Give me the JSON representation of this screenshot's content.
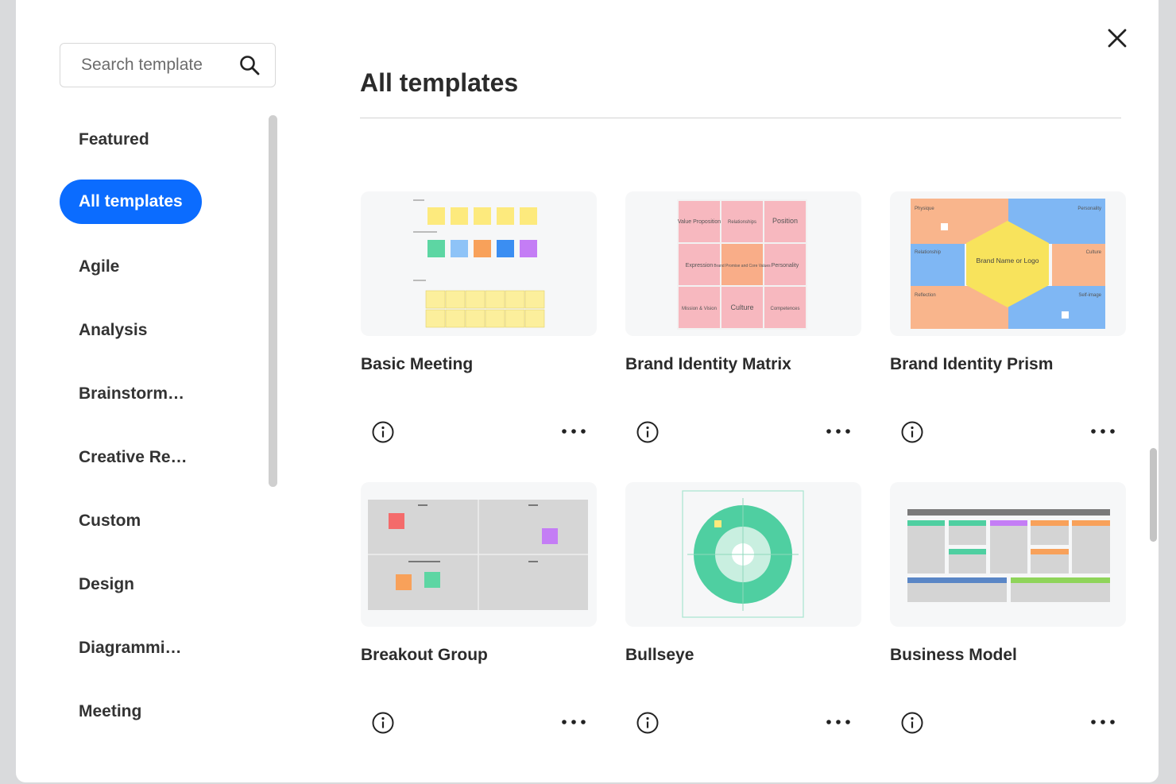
{
  "search": {
    "placeholder": "Search template"
  },
  "sidebar": {
    "items": [
      {
        "label": "Featured"
      },
      {
        "label": "All templates",
        "active": true
      },
      {
        "label": "Agile"
      },
      {
        "label": "Analysis"
      },
      {
        "label": "Brainstorm…"
      },
      {
        "label": "Creative Re…"
      },
      {
        "label": "Custom"
      },
      {
        "label": "Design"
      },
      {
        "label": "Diagrammi…"
      },
      {
        "label": "Meeting"
      }
    ]
  },
  "main": {
    "title": "All templates",
    "cards": [
      {
        "name": "Basic Meeting"
      },
      {
        "name": "Brand Identity Matrix",
        "cells": [
          "Value Proposition",
          "Relationships",
          "Position",
          "Expression",
          "Brand Promise and Core Values",
          "Personality",
          "Mission & Vision",
          "Culture",
          "Competences"
        ]
      },
      {
        "name": "Brand Identity Prism",
        "center": "Brand Name or Logo",
        "labels": [
          "Physique",
          "Personality",
          "Relationship",
          "Culture",
          "Reflection",
          "Self-image"
        ]
      },
      {
        "name": "Breakout Group"
      },
      {
        "name": "Bullseye"
      },
      {
        "name": "Business Model"
      }
    ]
  },
  "colors": {
    "accent": "#0b6cff",
    "sticky_yellow": "#fdea7d",
    "sticky_green": "#5dd6a3",
    "sticky_blue": "#8ec3f7",
    "sticky_orange": "#f8a15a",
    "sticky_purple": "#c47df5",
    "prism_orange": "#f9b58c",
    "prism_blue": "#7fb7f4",
    "prism_yellow": "#f8e35c",
    "bullseye_green": "#4fcfa1"
  },
  "icons": {
    "search": "search-icon",
    "close": "close-icon",
    "info": "info-icon",
    "more": "more-icon"
  }
}
